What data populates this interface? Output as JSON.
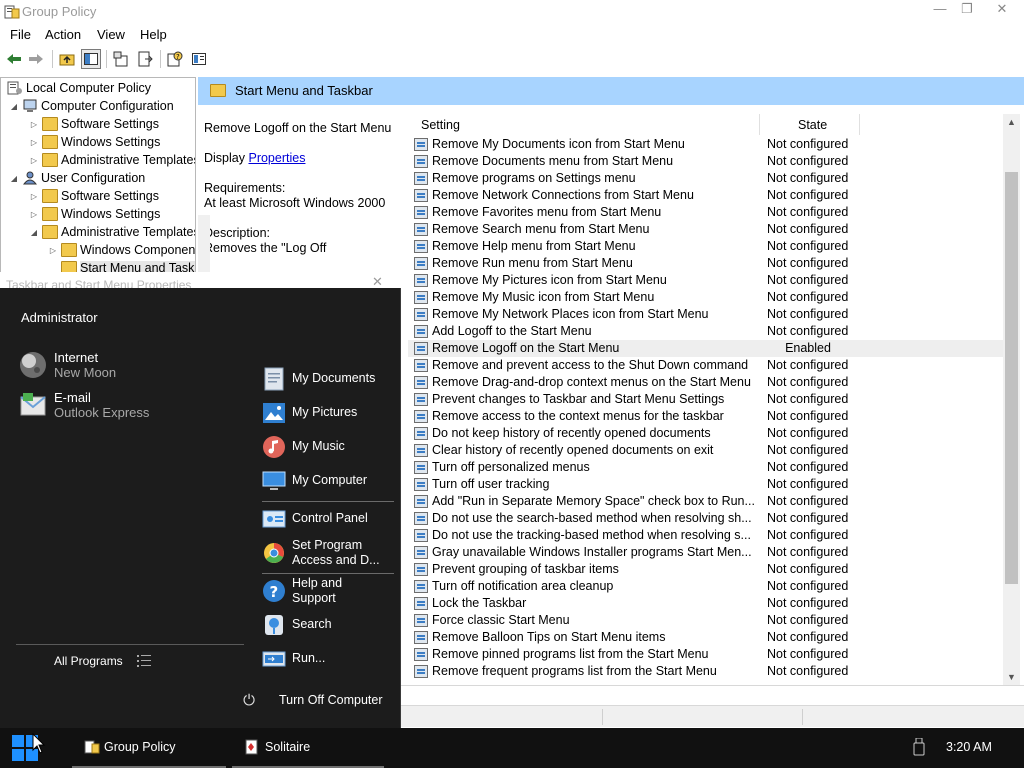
{
  "window": {
    "title": "Group Policy",
    "minimize_glyph": "—",
    "restore_glyph": "❐",
    "close_glyph": "✕"
  },
  "menubar": [
    "File",
    "Action",
    "View",
    "Help"
  ],
  "toolbar": {
    "icons": [
      "back-arrow-icon",
      "forward-arrow-icon",
      "up-folder-icon",
      "show-hide-tree-icon",
      "properties-icon",
      "export-list-icon",
      "help-icon",
      "extended-view-icon"
    ]
  },
  "tree": {
    "root": "Local Computer Policy",
    "computer_configuration": "Computer Configuration",
    "cc_software": "Software Settings",
    "cc_windows": "Windows Settings",
    "cc_admin": "Administrative Templates",
    "user_configuration": "User Configuration",
    "uc_software": "Software Settings",
    "uc_windows": "Windows Settings",
    "uc_admin": "Administrative Templates",
    "uc_windows_components": "Windows Components",
    "uc_start_menu": "Start Menu and Taskbar"
  },
  "header": {
    "title": "Start Menu and Taskbar"
  },
  "description": {
    "title": "Remove Logoff on the Start Menu",
    "display_prefix": "Display",
    "properties_link": "Properties",
    "requirements_label": "Requirements:",
    "requirements_value": "At least Microsoft Windows 2000",
    "description_label": "Description:",
    "description_text": "Removes the \"Log Off"
  },
  "list": {
    "columns": {
      "setting": "Setting",
      "state": "State"
    },
    "rows": [
      {
        "setting": "Remove My Documents icon from Start Menu",
        "state": "Not configured"
      },
      {
        "setting": "Remove Documents menu from Start Menu",
        "state": "Not configured"
      },
      {
        "setting": "Remove programs on Settings menu",
        "state": "Not configured"
      },
      {
        "setting": "Remove Network Connections from Start Menu",
        "state": "Not configured"
      },
      {
        "setting": "Remove Favorites menu from Start Menu",
        "state": "Not configured"
      },
      {
        "setting": "Remove Search menu from Start Menu",
        "state": "Not configured"
      },
      {
        "setting": "Remove Help menu from Start Menu",
        "state": "Not configured"
      },
      {
        "setting": "Remove Run menu from Start Menu",
        "state": "Not configured"
      },
      {
        "setting": "Remove My Pictures icon from Start Menu",
        "state": "Not configured"
      },
      {
        "setting": "Remove My Music icon from Start Menu",
        "state": "Not configured"
      },
      {
        "setting": "Remove My Network Places icon from Start Menu",
        "state": "Not configured"
      },
      {
        "setting": "Add Logoff to the Start Menu",
        "state": "Not configured"
      },
      {
        "setting": "Remove Logoff on the Start Menu",
        "state": "Enabled",
        "selected": true
      },
      {
        "setting": "Remove and prevent access to the Shut Down command",
        "state": "Not configured"
      },
      {
        "setting": "Remove Drag-and-drop context menus on the Start Menu",
        "state": "Not configured"
      },
      {
        "setting": "Prevent changes to Taskbar and Start Menu Settings",
        "state": "Not configured"
      },
      {
        "setting": "Remove access to the context menus for the taskbar",
        "state": "Not configured"
      },
      {
        "setting": "Do not keep history of recently opened documents",
        "state": "Not configured"
      },
      {
        "setting": "Clear history of recently opened documents on exit",
        "state": "Not configured"
      },
      {
        "setting": "Turn off personalized menus",
        "state": "Not configured"
      },
      {
        "setting": "Turn off user tracking",
        "state": "Not configured"
      },
      {
        "setting": "Add \"Run in Separate Memory Space\" check box to Run...",
        "state": "Not configured"
      },
      {
        "setting": "Do not use the search-based method when resolving sh...",
        "state": "Not configured"
      },
      {
        "setting": "Do not use the tracking-based method when resolving s...",
        "state": "Not configured"
      },
      {
        "setting": "Gray unavailable Windows Installer programs Start Men...",
        "state": "Not configured"
      },
      {
        "setting": "Prevent grouping of taskbar items",
        "state": "Not configured"
      },
      {
        "setting": "Turn off notification area cleanup",
        "state": "Not configured"
      },
      {
        "setting": "Lock the Taskbar",
        "state": "Not configured"
      },
      {
        "setting": "Force classic Start Menu",
        "state": "Not configured"
      },
      {
        "setting": "Remove Balloon Tips on Start Menu items",
        "state": "Not configured"
      },
      {
        "setting": "Remove pinned programs list from the Start Menu",
        "state": "Not configured"
      },
      {
        "setting": "Remove frequent programs list from the Start Menu",
        "state": "Not configured"
      }
    ]
  },
  "dialog_ghost": {
    "title": "Taskbar and Start Menu Properties",
    "close_glyph": "✕"
  },
  "start_menu": {
    "user": "Administrator",
    "pinned": [
      {
        "title": "Internet",
        "subtitle": "New Moon",
        "icon": "moon-browser-icon"
      },
      {
        "title": "E-mail",
        "subtitle": "Outlook Express",
        "icon": "outlook-express-icon"
      }
    ],
    "all_programs": "All Programs",
    "right_items": {
      "my_documents": "My Documents",
      "my_pictures": "My Pictures",
      "my_music": "My Music",
      "my_computer": "My Computer",
      "control_panel": "Control Panel",
      "set_program_line1": "Set Program",
      "set_program_line2": "Access and D...",
      "help_line1": "Help and",
      "help_line2": "Support",
      "search": "Search",
      "run": "Run..."
    },
    "turn_off": "Turn Off Computer"
  },
  "taskbar": {
    "tasks": [
      {
        "label": "Group Policy",
        "icon": "group-policy-icon"
      },
      {
        "label": "Solitaire",
        "icon": "solitaire-icon"
      }
    ],
    "clock": "3:20 AM"
  },
  "colors": {
    "header_bg": "#a8d4ff",
    "start_menu_bg": "#1c1c1c",
    "taskbar_bg": "#111111",
    "link": "#0000d8",
    "start_button": "#1e90ff"
  }
}
